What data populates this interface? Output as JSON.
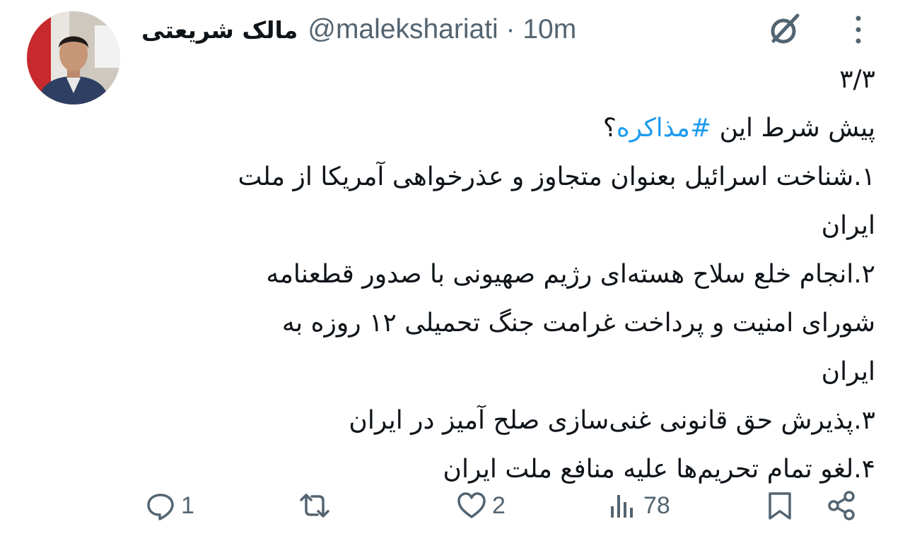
{
  "author": {
    "display_name": "مالک شریعتی",
    "handle_time": "@malekshariati · 10m"
  },
  "post": {
    "thread_counter": "۳/۳",
    "intro_prefix": "پیش شرط این ",
    "hashtag": "#مذاکره",
    "intro_suffix": "؟",
    "lines": [
      "۱.شناخت اسرائیل بعنوان متجاوز و عذرخواهی آمریکا از ملت",
      "ایران",
      "۲.انجام خلع سلاح هسته‌ای رژیم صهیونی با صدور قطعنامه",
      "شورای امنیت و پرداخت غرامت جنگ تحمیلی ۱۲ روزه به",
      "ایران",
      "۳.پذیرش حق قانونی غنی‌سازی صلح آمیز در ایران",
      "۴.لغو تمام تحریم‌ها علیه منافع ملت ایران"
    ]
  },
  "actions": {
    "reply_count": "1",
    "retweet_count": "",
    "like_count": "2",
    "views_count": "78"
  },
  "colors": {
    "text": "#0f1419",
    "secondary": "#536471",
    "link": "#1d9bf0"
  },
  "icons": [
    "grok-icon",
    "more-icon",
    "reply-icon",
    "retweet-icon",
    "like-icon",
    "views-icon",
    "bookmark-icon",
    "share-icon"
  ]
}
